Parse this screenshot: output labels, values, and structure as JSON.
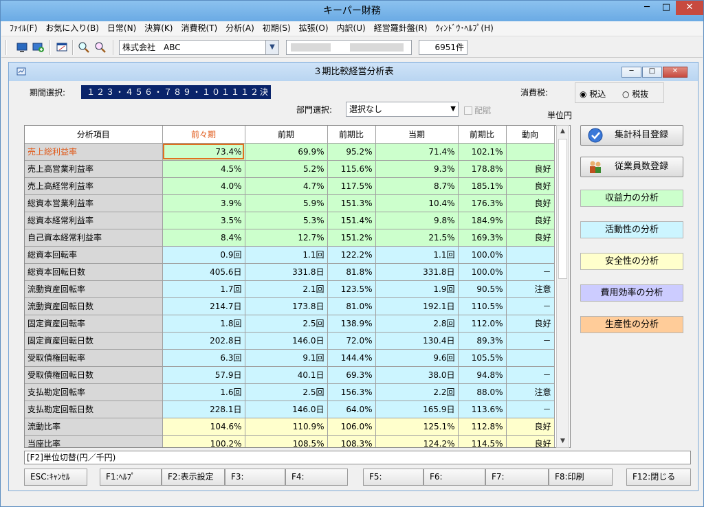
{
  "app": {
    "title": "キーパー財務",
    "controls": {
      "minimize": "─",
      "maximize": "□",
      "close": "✕"
    }
  },
  "menu": [
    "ﾌｧｲﾙ(F)",
    "お気に入り(B)",
    "日常(N)",
    "決算(K)",
    "消費税(T)",
    "分析(A)",
    "初期(S)",
    "拡張(O)",
    "内訳(U)",
    "経営羅針盤(R)",
    "ｳｨﾝﾄﾞｳ･ﾍﾙﾌﾟ(H)"
  ],
  "toolbar": {
    "company": "株式会社　ABC",
    "record_count": "6951件"
  },
  "window": {
    "title": "３期比較経営分析表",
    "period_label": "期間選択:",
    "period_value": "１２３・４５６・７８９・１０１１１２決",
    "tax_label": "消費税:",
    "tax_options": [
      "税込",
      "税抜"
    ],
    "dept_label": "部門選択:",
    "dept_value": "選択なし",
    "distrib_label": "配賦",
    "unit_label": "単位円"
  },
  "grid": {
    "headers": [
      "分析項目",
      "前々期",
      "前期",
      "前期比",
      "当期",
      "前期比",
      "動向"
    ],
    "rows": [
      {
        "name": "売上総利益率",
        "c1": "73.4%",
        "c2": "69.9%",
        "r1": "95.2%",
        "c3": "71.4%",
        "r2": "102.1%",
        "t": "",
        "color": "g"
      },
      {
        "name": "売上高営業利益率",
        "c1": "4.5%",
        "c2": "5.2%",
        "r1": "115.6%",
        "c3": "9.3%",
        "r2": "178.8%",
        "t": "良好",
        "color": "g"
      },
      {
        "name": "売上高経常利益率",
        "c1": "4.0%",
        "c2": "4.7%",
        "r1": "117.5%",
        "c3": "8.7%",
        "r2": "185.1%",
        "t": "良好",
        "color": "g"
      },
      {
        "name": "総資本営業利益率",
        "c1": "3.9%",
        "c2": "5.9%",
        "r1": "151.3%",
        "c3": "10.4%",
        "r2": "176.3%",
        "t": "良好",
        "color": "g"
      },
      {
        "name": "総資本経常利益率",
        "c1": "3.5%",
        "c2": "5.3%",
        "r1": "151.4%",
        "c3": "9.8%",
        "r2": "184.9%",
        "t": "良好",
        "color": "g"
      },
      {
        "name": "自己資本経常利益率",
        "c1": "8.4%",
        "c2": "12.7%",
        "r1": "151.2%",
        "c3": "21.5%",
        "r2": "169.3%",
        "t": "良好",
        "color": "g"
      },
      {
        "name": "総資本回転率",
        "c1": "0.9回",
        "c2": "1.1回",
        "r1": "122.2%",
        "c3": "1.1回",
        "r2": "100.0%",
        "t": "",
        "color": "c"
      },
      {
        "name": "総資本回転日数",
        "c1": "405.6日",
        "c2": "331.8日",
        "r1": "81.8%",
        "c3": "331.8日",
        "r2": "100.0%",
        "t": "－",
        "color": "c"
      },
      {
        "name": "流動資産回転率",
        "c1": "1.7回",
        "c2": "2.1回",
        "r1": "123.5%",
        "c3": "1.9回",
        "r2": "90.5%",
        "t": "注意",
        "color": "c"
      },
      {
        "name": "流動資産回転日数",
        "c1": "214.7日",
        "c2": "173.8日",
        "r1": "81.0%",
        "c3": "192.1日",
        "r2": "110.5%",
        "t": "－",
        "color": "c"
      },
      {
        "name": "固定資産回転率",
        "c1": "1.8回",
        "c2": "2.5回",
        "r1": "138.9%",
        "c3": "2.8回",
        "r2": "112.0%",
        "t": "良好",
        "color": "c"
      },
      {
        "name": "固定資産回転日数",
        "c1": "202.8日",
        "c2": "146.0日",
        "r1": "72.0%",
        "c3": "130.4日",
        "r2": "89.3%",
        "t": "－",
        "color": "c"
      },
      {
        "name": "受取債権回転率",
        "c1": "6.3回",
        "c2": "9.1回",
        "r1": "144.4%",
        "c3": "9.6回",
        "r2": "105.5%",
        "t": "",
        "color": "c"
      },
      {
        "name": "受取債権回転日数",
        "c1": "57.9日",
        "c2": "40.1日",
        "r1": "69.3%",
        "c3": "38.0日",
        "r2": "94.8%",
        "t": "－",
        "color": "c"
      },
      {
        "name": "支払勘定回転率",
        "c1": "1.6回",
        "c2": "2.5回",
        "r1": "156.3%",
        "c3": "2.2回",
        "r2": "88.0%",
        "t": "注意",
        "color": "c"
      },
      {
        "name": "支払勘定回転日数",
        "c1": "228.1日",
        "c2": "146.0日",
        "r1": "64.0%",
        "c3": "165.9日",
        "r2": "113.6%",
        "t": "－",
        "color": "c"
      },
      {
        "name": "流動比率",
        "c1": "104.6%",
        "c2": "110.9%",
        "r1": "106.0%",
        "c3": "125.1%",
        "r2": "112.8%",
        "t": "良好",
        "color": "y"
      },
      {
        "name": "当座比率",
        "c1": "100.2%",
        "c2": "108.5%",
        "r1": "108.3%",
        "c3": "124.2%",
        "r2": "114.5%",
        "t": "良好",
        "color": "y"
      }
    ]
  },
  "side": {
    "btn_register_accounts": "集計科目登録",
    "btn_register_staff": "従業員数登録",
    "analysis": [
      {
        "label": "収益力の分析",
        "color": "#ccffcc"
      },
      {
        "label": "活動性の分析",
        "color": "#ccf5ff"
      },
      {
        "label": "安全性の分析",
        "color": "#ffffcc"
      },
      {
        "label": "費用効率の分析",
        "color": "#ccccff"
      },
      {
        "label": "生産性の分析",
        "color": "#ffcc99"
      }
    ]
  },
  "status": "[F2]単位切替(円／千円)",
  "fkeys": [
    "ESC:ｷｬﾝｾﾙ",
    "F1:ﾍﾙﾌﾟ",
    "F2:表示設定",
    "F3:",
    "F4:",
    "F5:",
    "F6:",
    "F7:",
    "F8:印刷",
    "F12:閉じる"
  ]
}
